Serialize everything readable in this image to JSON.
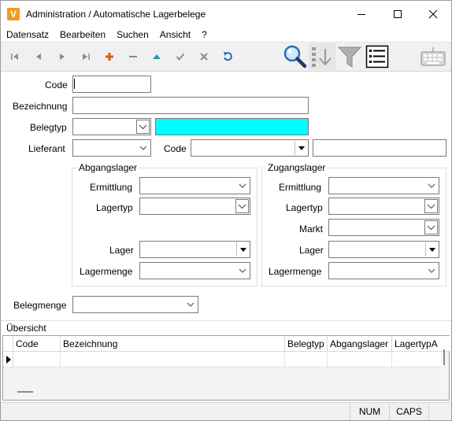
{
  "window": {
    "title": "Administration / Automatische Lagerbelege",
    "app_icon_letter": "V"
  },
  "menu": [
    "Datensatz",
    "Bearbeiten",
    "Suchen",
    "Ansicht",
    "?"
  ],
  "toolbar": {
    "icons": [
      "first-record-icon",
      "previous-record-icon",
      "next-record-icon",
      "last-record-icon",
      "add-record-icon",
      "delete-record-icon",
      "save-record-icon",
      "confirm-icon",
      "cancel-icon",
      "refresh-icon",
      "search-icon",
      "sort-icon",
      "filter-icon",
      "list-view-icon",
      "keyboard-icon"
    ]
  },
  "form": {
    "code_label": "Code",
    "code_value": "",
    "bezeichnung_label": "Bezeichnung",
    "bezeichnung_value": "",
    "belegtyp_label": "Belegtyp",
    "belegtyp_value": "",
    "belegtyp_color": "#00ffff",
    "lieferant_label": "Lieferant",
    "lieferant_value": "",
    "lieferant_code_label": "Code",
    "lieferant_code_value": "",
    "abgangslager": {
      "title": "Abgangslager",
      "ermittlung_label": "Ermittlung",
      "lagertyp_label": "Lagertyp",
      "lager_label": "Lager",
      "lagermenge_label": "Lagermenge"
    },
    "zugangslager": {
      "title": "Zugangslager",
      "ermittlung_label": "Ermittlung",
      "lagertyp_label": "Lagertyp",
      "markt_label": "Markt",
      "lager_label": "Lager",
      "lagermenge_label": "Lagermenge"
    },
    "belegmenge_label": "Belegmenge"
  },
  "overview": {
    "title": "Übersicht",
    "columns": [
      "Code",
      "Bezeichnung",
      "Belegtyp",
      "Abgangslager",
      "LagertypA"
    ],
    "rows": [
      [
        "",
        "",
        "",
        "",
        ""
      ]
    ]
  },
  "status": {
    "num": "NUM",
    "caps": "CAPS"
  }
}
